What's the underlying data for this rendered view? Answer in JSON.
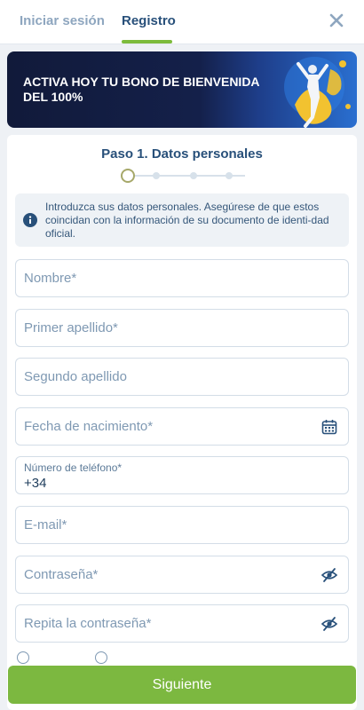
{
  "tabs": {
    "login_label": "Iniciar sesión",
    "register_label": "Registro"
  },
  "close_icon": "close-icon",
  "banner": {
    "text_line1": "ACTIVA HOY TU BONO DE BIENVENIDA",
    "text_line2": "DEL 100%"
  },
  "step": {
    "title": "Paso 1. Datos personales",
    "current": 1,
    "total": 4
  },
  "info": {
    "icon": "info-icon",
    "text": "Introduzca sus datos personales. Asegúrese de que estos coincidan con la información de su documento de identi-dad oficial."
  },
  "form": {
    "first_name_placeholder": "Nombre*",
    "surname1_placeholder": "Primer apellido*",
    "surname2_placeholder": "Segundo apellido",
    "birthdate_placeholder": "Fecha de nacimiento*",
    "birthdate_icon": "calendar-icon",
    "phone_label": "Número de teléfono*",
    "phone_value": "+34",
    "email_placeholder": "E-mail*",
    "password_placeholder": "Contraseña*",
    "password_icon": "eye-slash-icon",
    "password_repeat_placeholder": "Repita la contraseña*",
    "password_repeat_icon": "eye-slash-icon"
  },
  "next_button": "Siguiente",
  "colors": {
    "accent_green": "#7cb840",
    "title_blue": "#28507a",
    "banner_dark": "#111a3a"
  }
}
